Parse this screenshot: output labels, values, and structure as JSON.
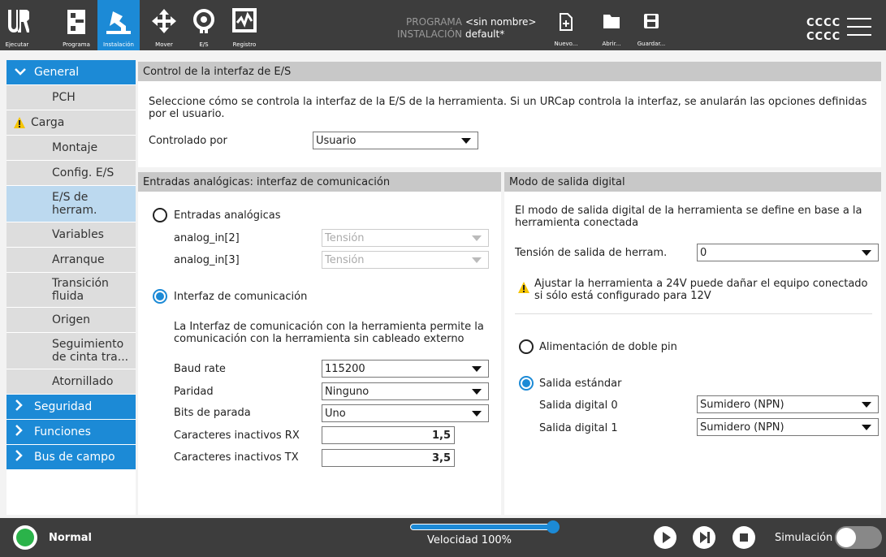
{
  "topbar": {
    "nav": [
      {
        "label": "Ejecutar",
        "icon": "ur-logo-icon"
      },
      {
        "label": "Programa",
        "icon": "program-icon"
      },
      {
        "label": "Instalación",
        "icon": "installation-icon"
      },
      {
        "label": "Mover",
        "icon": "move-icon"
      },
      {
        "label": "E/S",
        "icon": "io-icon"
      },
      {
        "label": "Registro",
        "icon": "log-icon"
      }
    ],
    "program_label": "PROGRAMA",
    "program_value": "<sin nombre>",
    "installation_label": "INSTALACIÓN",
    "installation_value": "default*",
    "new_label": "Nuevo...",
    "open_label": "Abrir...",
    "save_label": "Guardar...",
    "user_line1": "CCCC",
    "user_line2": "CCCC"
  },
  "sidebar": {
    "general": "General",
    "items": [
      {
        "label": "PCH"
      },
      {
        "label": "Carga"
      },
      {
        "label": "Montaje"
      },
      {
        "label": "Config. E/S"
      },
      {
        "label": "E/S de herram."
      },
      {
        "label": "Variables"
      },
      {
        "label": "Arranque"
      },
      {
        "label": "Transición fluida"
      },
      {
        "label": "Origen"
      },
      {
        "label": "Seguimiento de cinta tra..."
      },
      {
        "label": "Atornillado"
      }
    ],
    "categories": [
      "Seguridad",
      "Funciones",
      "Bus de campo"
    ]
  },
  "control": {
    "header": "Control de la interfaz de E/S",
    "desc": "Seleccione cómo se controla la interfaz de la E/S de la herramienta. Si un URCap controla la interfaz, se anularán las opciones definidas por el usuario.",
    "controlled_by_label": "Controlado por",
    "controlled_by_value": "Usuario"
  },
  "analog": {
    "header": "Entradas analógicas: interfaz de comunicación",
    "analog_inputs_label": "Entradas analógicas",
    "ain2_label": "analog_in[2]",
    "ain2_value": "Tensión",
    "ain3_label": "analog_in[3]",
    "ain3_value": "Tensión",
    "comm_label": "Interfaz de comunicación",
    "comm_desc": "La Interfaz de comunicación con la herramienta permite la comunicación con la herramienta sin cableado externo",
    "baud_label": "Baud rate",
    "baud_value": "115200",
    "parity_label": "Paridad",
    "parity_value": "Ninguno",
    "stop_label": "Bits de parada",
    "stop_value": "Uno",
    "rx_label": "Caracteres inactivos RX",
    "rx_value": "1,5",
    "tx_label": "Caracteres inactivos TX",
    "tx_value": "3,5"
  },
  "digital": {
    "header": "Modo de salida digital",
    "desc": "El modo de salida digital de la herramienta se define en base a la herramienta conectada",
    "voltage_label": "Tensión de salida de herram.",
    "voltage_value": "0",
    "warning": "Ajustar la herramienta a 24V puede dañar el equipo conectado si sólo está configurado para 12V",
    "dual_pin_label": "Alimentación de doble pin",
    "standard_label": "Salida estándar",
    "do0_label": "Salida digital 0",
    "do0_value": "Sumidero (NPN)",
    "do1_label": "Salida digital 1",
    "do1_value": "Sumidero (NPN)"
  },
  "bottombar": {
    "status": "Normal",
    "speed_label": "Velocidad 100%",
    "speed_fraction": 1.0,
    "simulation_label": "Simulación",
    "colors": {
      "status": "#2bb34a",
      "accent": "#1c8ad6"
    }
  }
}
